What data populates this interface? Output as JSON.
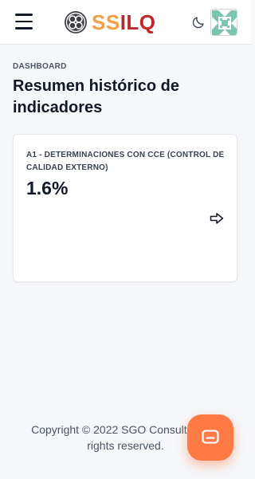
{
  "header": {
    "menu_icon": "hamburger-icon",
    "brand": {
      "part1": "SS",
      "part2": "ILQ",
      "color1": "#f59e42",
      "color2": "#c0272d"
    },
    "theme_icon": "moon-icon",
    "avatar_icon": "avatar-pattern"
  },
  "breadcrumb": "DASHBOARD",
  "page_title": "Resumen histórico de indicadores",
  "card": {
    "title": "A1 - DETERMINACIONES CON CCE (CONTROL DE CALIDAD EXTERNO)",
    "value": "1.6%",
    "arrow_icon": "arrow-right-icon"
  },
  "footer": {
    "line1": "Copyright © 2022 SGO Consulting. All",
    "line2": "rights reserved."
  },
  "chat_fab": {
    "icon": "chat-icon",
    "color": "#ff7a45"
  }
}
